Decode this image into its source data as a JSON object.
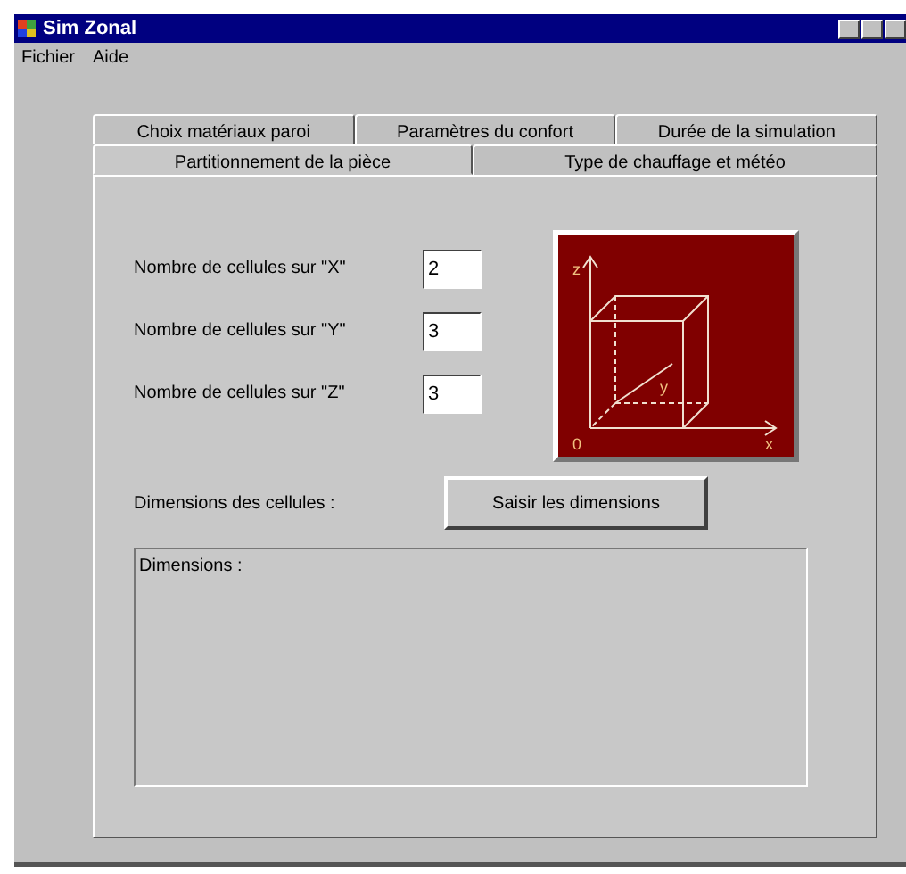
{
  "window": {
    "title": "Sim Zonal"
  },
  "menu": [
    "Fichier",
    "Aide"
  ],
  "tab_rows": [
    [
      {
        "label": "Choix matériaux paroi",
        "selected": false
      },
      {
        "label": "Paramètres du confort",
        "selected": false
      },
      {
        "label": "Durée de la simulation",
        "selected": false
      }
    ],
    [
      {
        "label": "Partitionnement de la pièce",
        "selected": true
      },
      {
        "label": "Type de chauffage et météo",
        "selected": false
      }
    ]
  ],
  "cell_fields": [
    {
      "label": "Nombre de cellules sur \"X\"",
      "value": "2"
    },
    {
      "label": "Nombre de cellules sur \"Y\"",
      "value": "3"
    },
    {
      "label": "Nombre de cellules sur \"Z\"",
      "value": "3"
    }
  ],
  "diagram": {
    "axis_labels": [
      "z",
      "y",
      "0",
      "x"
    ]
  },
  "dimensions_label": "Dimensions des cellules :",
  "dimensions_button": "Saisir les dimensions",
  "dimensions_group": {
    "title": "Dimensions :"
  }
}
